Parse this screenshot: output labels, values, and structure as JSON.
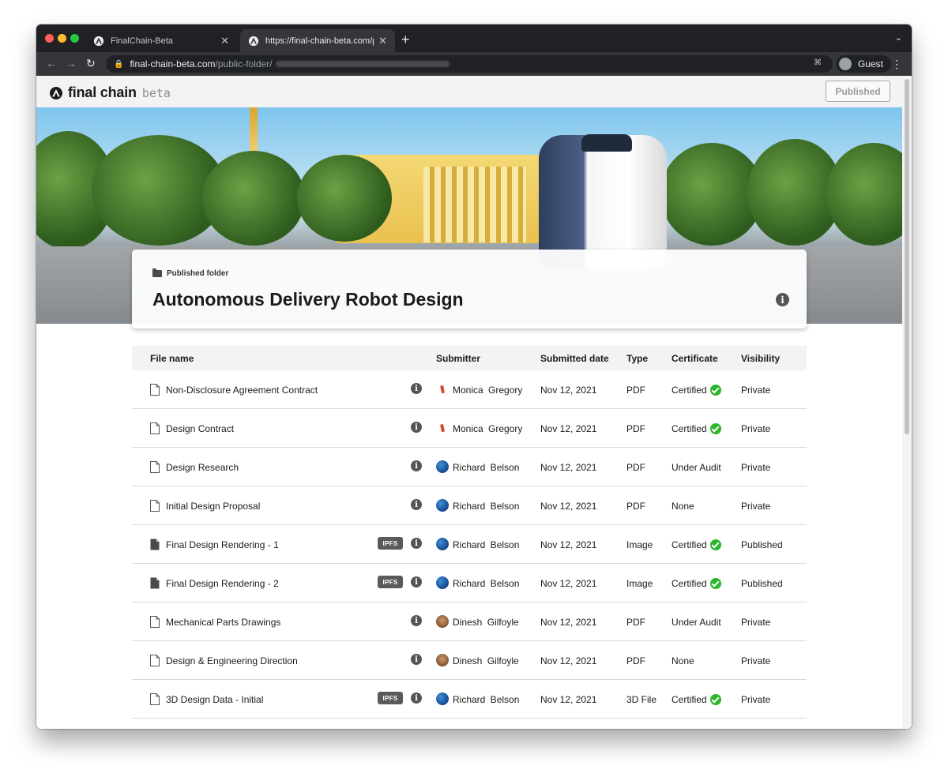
{
  "browser": {
    "tabs": [
      {
        "title": "FinalChain-Beta",
        "active": false
      },
      {
        "title": "https://final-chain-beta.com/pu",
        "active": true
      }
    ],
    "url": {
      "host": "final-chain-beta.com",
      "path": "/public-folder/"
    },
    "profile_label": "Guest"
  },
  "app": {
    "brand": "final chain",
    "beta": "beta",
    "published_button": "Published"
  },
  "folder": {
    "kicker": "Published folder",
    "title": "Autonomous Delivery Robot Design"
  },
  "table": {
    "headers": {
      "file_name": "File name",
      "submitter": "Submitter",
      "submitted_date": "Submitted date",
      "type": "Type",
      "certificate": "Certificate",
      "visibility": "Visibility"
    },
    "rows": [
      {
        "name": "Non-Disclosure Agreement Contract",
        "ipfs": false,
        "submitter": "Monica  Gregory",
        "date": "Nov 12, 2021",
        "type": "PDF",
        "certificate": "Certified",
        "certified": true,
        "visibility": "Private"
      },
      {
        "name": "Design Contract",
        "ipfs": false,
        "submitter": "Monica  Gregory",
        "date": "Nov 12, 2021",
        "type": "PDF",
        "certificate": "Certified",
        "certified": true,
        "visibility": "Private"
      },
      {
        "name": "Design Research",
        "ipfs": false,
        "submitter": "Richard  Belson",
        "date": "Nov 12, 2021",
        "type": "PDF",
        "certificate": "Under Audit",
        "certified": false,
        "visibility": "Private"
      },
      {
        "name": "Initial Design Proposal",
        "ipfs": false,
        "submitter": "Richard  Belson",
        "date": "Nov 12, 2021",
        "type": "PDF",
        "certificate": "None",
        "certified": false,
        "visibility": "Private"
      },
      {
        "name": "Final Design Rendering - 1",
        "ipfs": true,
        "submitter": "Richard  Belson",
        "date": "Nov 12, 2021",
        "type": "Image",
        "certificate": "Certified",
        "certified": true,
        "visibility": "Published"
      },
      {
        "name": "Final Design Rendering - 2",
        "ipfs": true,
        "submitter": "Richard  Belson",
        "date": "Nov 12, 2021",
        "type": "Image",
        "certificate": "Certified",
        "certified": true,
        "visibility": "Published"
      },
      {
        "name": "Mechanical Parts Drawings",
        "ipfs": false,
        "submitter": "Dinesh  Gilfoyle",
        "date": "Nov 12, 2021",
        "type": "PDF",
        "certificate": "Under Audit",
        "certified": false,
        "visibility": "Private"
      },
      {
        "name": "Design & Engineering Direction",
        "ipfs": false,
        "submitter": "Dinesh  Gilfoyle",
        "date": "Nov 12, 2021",
        "type": "PDF",
        "certificate": "None",
        "certified": false,
        "visibility": "Private"
      },
      {
        "name": "3D Design Data - Initial",
        "ipfs": true,
        "submitter": "Richard  Belson",
        "date": "Nov 12, 2021",
        "type": "3D File",
        "certificate": "Certified",
        "certified": true,
        "visibility": "Private"
      }
    ],
    "ipfs_label": "IPFS"
  },
  "colors": {
    "certified_check": "#2db52d",
    "brand_dark": "#1b1b1b",
    "chrome_dark": "#202124"
  }
}
